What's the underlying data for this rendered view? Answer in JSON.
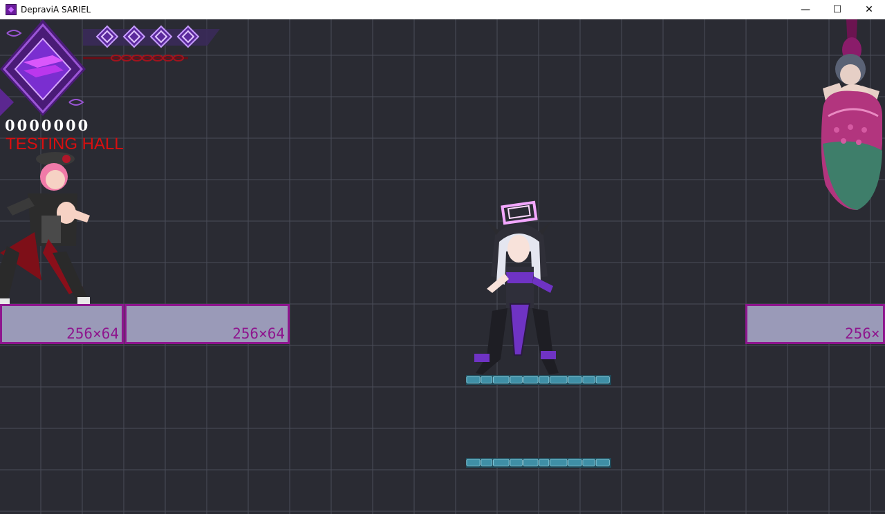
{
  "window": {
    "title": "DepraviA SARIEL",
    "controls": {
      "minimize": "—",
      "maximize": "☐",
      "close": "✕"
    }
  },
  "hud": {
    "score": "0000000",
    "area_name": "TESTING HALL",
    "life_icon_count": 4,
    "chain_links": 7
  },
  "platforms": [
    {
      "label": "256×64"
    },
    {
      "label": "256×64"
    },
    {
      "label": "256×"
    }
  ],
  "colors": {
    "background": "#2a2b33",
    "grid_line": "#4a4c58",
    "block_fill": "#9a9ab8",
    "block_border": "#8e168e",
    "area_name": "#d80f10",
    "stone": "#3f8fa6"
  },
  "sprites": {
    "player": "nun-heroine",
    "enemy_left": "pink-haired-fighter",
    "enemy_right": "plant-pod-monster"
  }
}
